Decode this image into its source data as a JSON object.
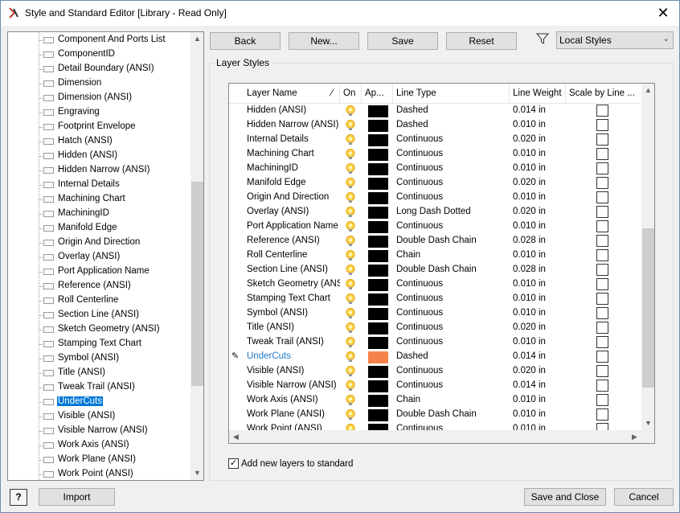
{
  "window": {
    "title": "Style and Standard Editor [Library - Read Only]"
  },
  "tree": {
    "items": [
      "Component And Ports List",
      "ComponentID",
      "Detail Boundary (ANSI)",
      "Dimension",
      "Dimension (ANSI)",
      "Engraving",
      "Footprint Envelope",
      "Hatch (ANSI)",
      "Hidden (ANSI)",
      "Hidden Narrow (ANSI)",
      "Internal Details",
      "Machining Chart",
      "MachiningID",
      "Manifold Edge",
      "Origin And Direction",
      "Overlay (ANSI)",
      "Port Application Name",
      "Reference (ANSI)",
      "Roll Centerline",
      "Section Line (ANSI)",
      "Sketch Geometry (ANSI)",
      "Stamping Text Chart",
      "Symbol (ANSI)",
      "Title (ANSI)",
      "Tweak Trail (ANSI)",
      "UnderCuts",
      "Visible (ANSI)",
      "Visible Narrow (ANSI)",
      "Work Axis (ANSI)",
      "Work Plane (ANSI)",
      "Work Point (ANSI)"
    ],
    "selected": "UnderCuts"
  },
  "toolbar": {
    "back": "Back",
    "new": "New...",
    "save": "Save",
    "reset": "Reset"
  },
  "filter": {
    "selected": "Local Styles"
  },
  "group": {
    "title": "Layer Styles"
  },
  "grid": {
    "headers": {
      "name": "Layer Name",
      "on": "On",
      "appearance": "Ap...",
      "line_type": "Line Type",
      "line_weight": "Line Weight",
      "scale": "Scale by Line ..."
    },
    "rows": [
      {
        "name": "Hidden (ANSI)",
        "line_type": "Dashed",
        "weight": "0.014 in",
        "color": "#000000"
      },
      {
        "name": "Hidden Narrow (ANSI)",
        "line_type": "Dashed",
        "weight": "0.010 in",
        "color": "#000000"
      },
      {
        "name": "Internal Details",
        "line_type": "Continuous",
        "weight": "0.020 in",
        "color": "#000000"
      },
      {
        "name": "Machining Chart",
        "line_type": "Continuous",
        "weight": "0.010 in",
        "color": "#000000"
      },
      {
        "name": "MachiningID",
        "line_type": "Continuous",
        "weight": "0.010 in",
        "color": "#000000"
      },
      {
        "name": "Manifold Edge",
        "line_type": "Continuous",
        "weight": "0.020 in",
        "color": "#000000"
      },
      {
        "name": "Origin And Direction",
        "line_type": "Continuous",
        "weight": "0.010 in",
        "color": "#000000"
      },
      {
        "name": "Overlay (ANSI)",
        "line_type": "Long Dash Dotted",
        "weight": "0.020 in",
        "color": "#000000"
      },
      {
        "name": "Port Application Name",
        "line_type": "Continuous",
        "weight": "0.010 in",
        "color": "#000000"
      },
      {
        "name": "Reference (ANSI)",
        "line_type": "Double Dash Chain",
        "weight": "0.028 in",
        "color": "#000000"
      },
      {
        "name": "Roll Centerline",
        "line_type": "Chain",
        "weight": "0.010 in",
        "color": "#000000"
      },
      {
        "name": "Section Line (ANSI)",
        "line_type": "Double Dash Chain",
        "weight": "0.028 in",
        "color": "#000000"
      },
      {
        "name": "Sketch Geometry (ANSI)",
        "line_type": "Continuous",
        "weight": "0.010 in",
        "color": "#000000"
      },
      {
        "name": "Stamping Text Chart",
        "line_type": "Continuous",
        "weight": "0.010 in",
        "color": "#000000"
      },
      {
        "name": "Symbol (ANSI)",
        "line_type": "Continuous",
        "weight": "0.010 in",
        "color": "#000000"
      },
      {
        "name": "Title (ANSI)",
        "line_type": "Continuous",
        "weight": "0.020 in",
        "color": "#000000"
      },
      {
        "name": "Tweak Trail (ANSI)",
        "line_type": "Continuous",
        "weight": "0.010 in",
        "color": "#000000"
      },
      {
        "name": "UnderCuts",
        "line_type": "Dashed",
        "weight": "0.014 in",
        "color": "#f4834a",
        "current": true
      },
      {
        "name": "Visible (ANSI)",
        "line_type": "Continuous",
        "weight": "0.020 in",
        "color": "#000000"
      },
      {
        "name": "Visible Narrow (ANSI)",
        "line_type": "Continuous",
        "weight": "0.014 in",
        "color": "#000000"
      },
      {
        "name": "Work Axis (ANSI)",
        "line_type": "Chain",
        "weight": "0.010 in",
        "color": "#000000"
      },
      {
        "name": "Work Plane (ANSI)",
        "line_type": "Double Dash Chain",
        "weight": "0.010 in",
        "color": "#000000"
      },
      {
        "name": "Work Point (ANSI)",
        "line_type": "Continuous",
        "weight": "0.010 in",
        "color": "#000000"
      }
    ]
  },
  "options": {
    "add_new_layers": "Add new layers to standard",
    "add_new_layers_checked": true
  },
  "footer": {
    "help": "?",
    "import": "Import",
    "save_close": "Save and Close",
    "cancel": "Cancel"
  }
}
